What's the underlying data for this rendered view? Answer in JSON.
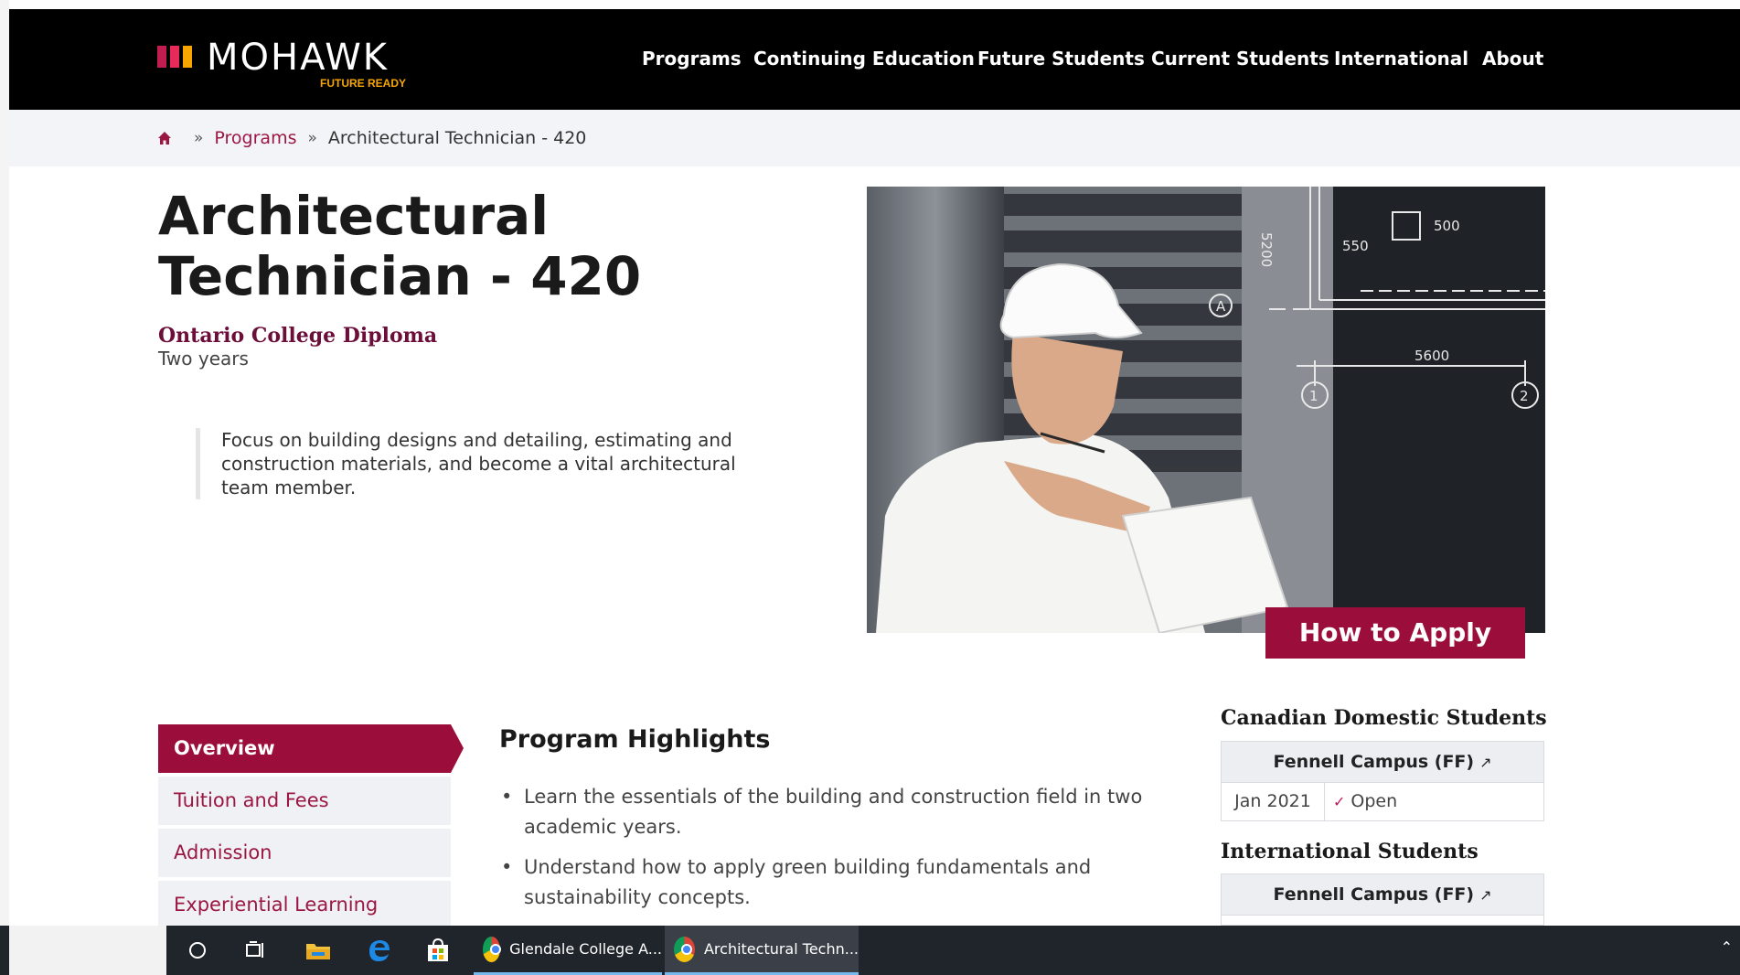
{
  "header": {
    "logo_name": "MOHAWK",
    "logo_tagline": "FUTURE READY",
    "nav": [
      "Programs",
      "Continuing Education",
      "Future Students",
      "Current Students",
      "International",
      "About"
    ]
  },
  "breadcrumb": {
    "home_icon": "home-icon",
    "separator": "»",
    "items": [
      "Programs",
      "Architectural Technician - 420"
    ]
  },
  "program": {
    "title": "Architectural Technician - 420",
    "credential": "Ontario College Diploma",
    "duration": "Two years",
    "blurb": "Focus on building designs and detailing, estimating and construction materials, and become a vital architectural team member.",
    "apply_label": "How to Apply"
  },
  "hero": {
    "drawing_labels": [
      "5200",
      "550",
      "500",
      "5600",
      "1",
      "2",
      "A"
    ]
  },
  "subnav": {
    "items": [
      "Overview",
      "Tuition and Fees",
      "Admission",
      "Experiential Learning"
    ],
    "active": "Overview"
  },
  "highlights": {
    "title": "Program Highlights",
    "items": [
      "Learn the essentials of the building and construction field in two academic years.",
      "Understand how to apply green building fundamentals and sustainability concepts."
    ]
  },
  "intakes": {
    "domestic": {
      "heading": "Canadian Domestic Students",
      "campus": "Fennell Campus (FF)",
      "date": "Jan 2021",
      "status": "Open"
    },
    "international": {
      "heading": "International Students",
      "campus": "Fennell Campus (FF)"
    }
  },
  "taskbar": {
    "apps": [
      "Glendale College A...",
      "Architectural Techn..."
    ],
    "icons": [
      "cortana-icon",
      "task-view-icon",
      "file-explorer-icon",
      "edge-icon",
      "store-icon"
    ]
  },
  "colors": {
    "brand_maroon": "#9b0d3a",
    "credential_purple": "#6b0f3a",
    "header_bg": "#000000",
    "logo_orange": "#f7a600"
  }
}
